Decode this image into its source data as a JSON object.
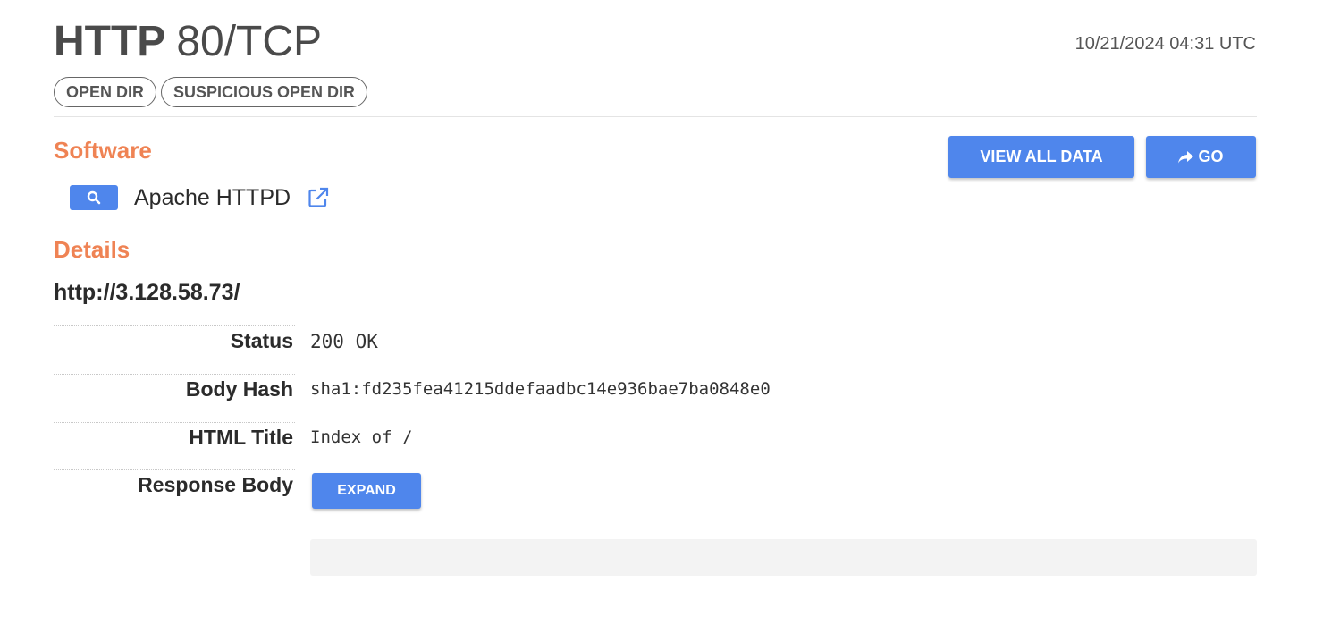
{
  "header": {
    "protocol": "HTTP",
    "port": "80/TCP",
    "timestamp": "10/21/2024 04:31 UTC",
    "tags": [
      "OPEN DIR",
      "SUSPICIOUS OPEN DIR"
    ]
  },
  "software": {
    "heading": "Software",
    "name": "Apache HTTPD",
    "search_icon": "search-icon",
    "link_icon": "external-link-icon"
  },
  "actions": {
    "view_all_label": "VIEW ALL DATA",
    "go_label": "GO",
    "go_icon": "share-arrow-icon"
  },
  "details": {
    "heading": "Details",
    "url": "http://3.128.58.73/",
    "rows": [
      {
        "label": "Status",
        "value": "200 OK"
      },
      {
        "label": "Body Hash",
        "value": "sha1:fd235fea41215ddefaadbc14e936bae7ba0848e0"
      },
      {
        "label": "HTML Title",
        "value": "Index of /"
      },
      {
        "label": "Response Body",
        "button": "EXPAND"
      }
    ]
  },
  "colors": {
    "accent": "#ef8354",
    "button": "#4f86ec"
  }
}
